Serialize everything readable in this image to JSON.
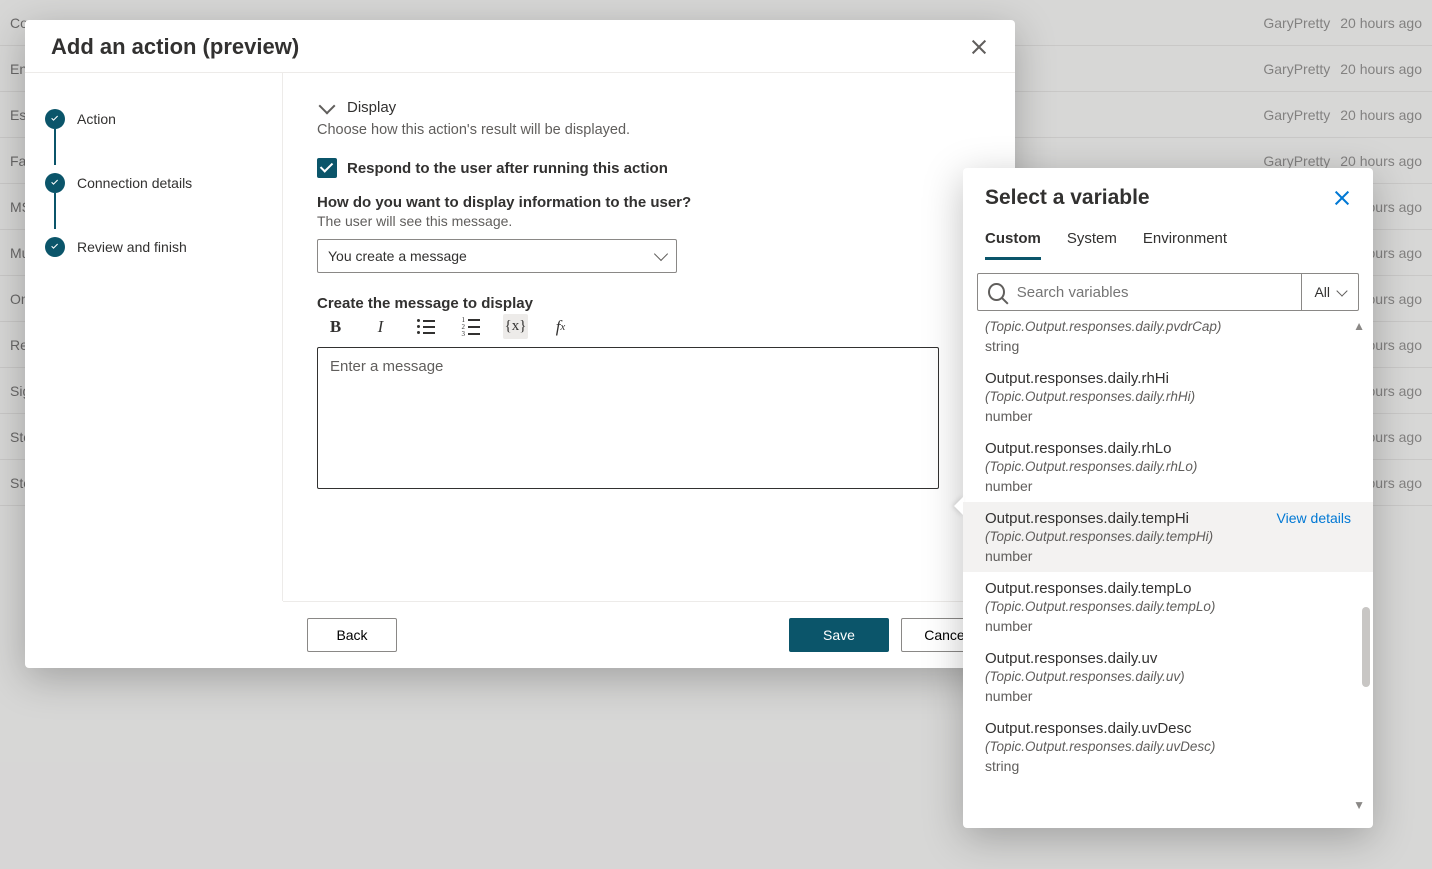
{
  "background": {
    "rows": [
      "Co",
      "End",
      "Esc",
      "Fall",
      "MS",
      "Mu",
      "On",
      "Re",
      "Sig",
      "Sto",
      "Sto"
    ],
    "meta_author": "GaryPretty",
    "meta_time": "20 hours ago"
  },
  "dialog": {
    "title": "Add an action (preview)",
    "steps": [
      "Action",
      "Connection details",
      "Review and finish"
    ],
    "section": {
      "display_heading": "Display",
      "display_desc": "Choose how this action's result will be displayed.",
      "respond_check_label": "Respond to the user after running this action",
      "respond_checked": true,
      "how_display_q": "How do you want to display information to the user?",
      "how_display_sub": "The user will see this message.",
      "how_display_value": "You create a message",
      "create_msg_label": "Create the message to display",
      "editor_placeholder": "Enter a message"
    },
    "buttons": {
      "back": "Back",
      "save": "Save",
      "cancel": "Cancel"
    }
  },
  "flyout": {
    "title": "Select a variable",
    "tabs": {
      "custom": "Custom",
      "system": "System",
      "environment": "Environment"
    },
    "active_tab": "custom",
    "search_placeholder": "Search variables",
    "filter_label": "All",
    "top_remnant": {
      "path": "(Topic.Output.responses.daily.pvdrCap)",
      "type": "string"
    },
    "items": [
      {
        "name": "Output.responses.daily.rhHi",
        "path": "(Topic.Output.responses.daily.rhHi)",
        "type": "number",
        "hovered": false
      },
      {
        "name": "Output.responses.daily.rhLo",
        "path": "(Topic.Output.responses.daily.rhLo)",
        "type": "number",
        "hovered": false
      },
      {
        "name": "Output.responses.daily.tempHi",
        "path": "(Topic.Output.responses.daily.tempHi)",
        "type": "number",
        "hovered": true
      },
      {
        "name": "Output.responses.daily.tempLo",
        "path": "(Topic.Output.responses.daily.tempLo)",
        "type": "number",
        "hovered": false
      },
      {
        "name": "Output.responses.daily.uv",
        "path": "(Topic.Output.responses.daily.uv)",
        "type": "number",
        "hovered": false
      },
      {
        "name": "Output.responses.daily.uvDesc",
        "path": "(Topic.Output.responses.daily.uvDesc)",
        "type": "string",
        "hovered": false
      }
    ],
    "view_details": "View details"
  }
}
